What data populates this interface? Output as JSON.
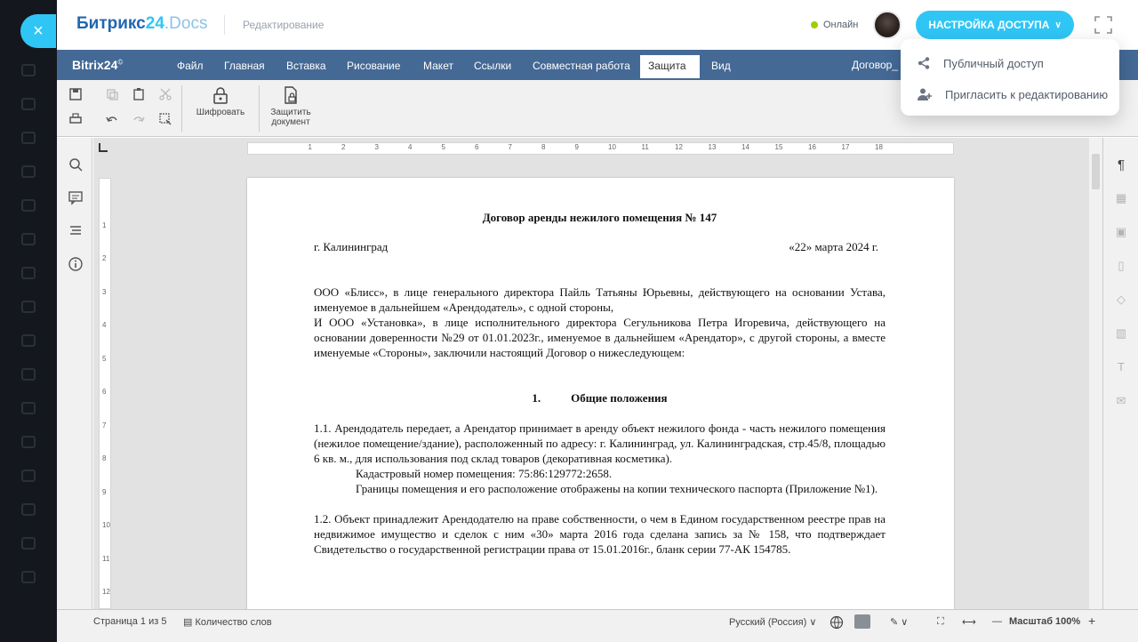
{
  "overlay": {
    "close_glyph": "×"
  },
  "header": {
    "logo_main": "Битрикс",
    "logo_num": "24",
    "logo_sub": ".Docs",
    "mode": "Редактирование",
    "online": "Онлайн",
    "access_button": "НАСТРОЙКА ДОСТУПА",
    "chevron": "∨"
  },
  "dropdown": {
    "items": [
      {
        "label": "Публичный доступ",
        "icon": "share-icon"
      },
      {
        "label": "Пригласить к редактированию",
        "icon": "add-user-icon"
      }
    ]
  },
  "menubar": {
    "brand": "Bitrix24",
    "brand_mark": "©",
    "tabs": [
      "Файл",
      "Главная",
      "Вставка",
      "Рисование",
      "Макет",
      "Ссылки",
      "Совместная работа",
      "Защита",
      "Вид"
    ],
    "active_tab": "Защита",
    "docname": "Договор_"
  },
  "toolbar": {
    "encrypt": "Шифровать",
    "protect_line1": "Защитить",
    "protect_line2": "документ"
  },
  "document": {
    "title": "Договор аренды нежилого помещения № 147",
    "city": "г. Калининград",
    "date": "«22» марта 2024 г.",
    "para1": "ООО «Блисс», в лице генерального директора Пайль Татьяны Юрьевны, действующего на основании Устава, именуемое в дальнейшем «Арендодатель», с одной стороны,",
    "para2": "И ООО «Установка», в лице исполнительного директора Сегульникова Петра Игоревича, действующего на основании доверенности №29 от 01.01.2023г., именуемое в дальнейшем «Арендатор», с другой стороны, а вместе именуемые «Стороны», заключили настоящий Договор о нижеследующем:",
    "section1_num": "1.",
    "section1_title": "Общие положения",
    "clause1_1": "1.1. Арендодатель передает, а Арендатор принимает в аренду объект нежилого фонда - часть нежилого помещения (нежилое помещение/здание), расположенный по адресу: г. Калининград, ул. Калининградская, стр.45/8, площадью 6 кв. м., для использования под склад товаров (декоративная косметика).",
    "cadastral": "Кадастровый номер помещения: 75:86:129772:2658.",
    "boundaries": "Границы помещения и его расположение отображены на копии технического паспорта (Приложение №1).",
    "clause1_2": "1.2. Объект принадлежит Арендодателю на праве собственности, о чем в Едином государственном реестре прав на недвижимое имущество и сделок с ним «30» марта 2016 года сделана запись за № 158, что подтверждает Свидетельство о государственной регистрации права от 15.01.2016г., бланк серии 77-АК 154785."
  },
  "status": {
    "page": "Страница 1 из 5",
    "wordcount": "Количество слов",
    "language": "Русский (Россия)",
    "zoom": "Масштаб 100%",
    "minus": "—",
    "plus": "+"
  },
  "colors": {
    "accent": "#2fc6f6",
    "menubar": "#446995",
    "online": "#9dcf00"
  }
}
